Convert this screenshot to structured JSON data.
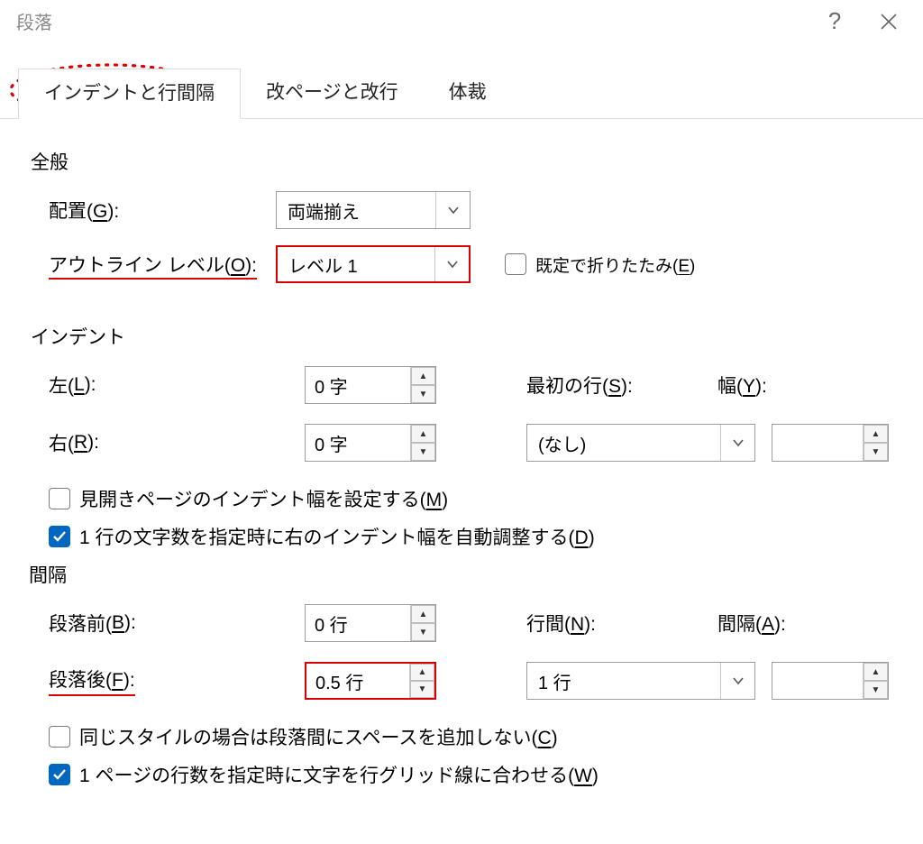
{
  "window": {
    "title": "段落",
    "help": "?",
    "close": "✕"
  },
  "tabs": {
    "t1": "インデントと行間隔",
    "t2": "改ページと改行",
    "t3": "体裁"
  },
  "general": {
    "section": "全般",
    "alignment_label_pre": "配置(",
    "alignment_key": "G",
    "alignment_label_post": "):",
    "alignment_value": "両端揃え",
    "outline_label_pre": "アウトライン レベル(",
    "outline_key": "O",
    "outline_label_post": "):",
    "outline_value": "レベル 1",
    "collapse_cb_pre": "既定で折りたたみ(",
    "collapse_key": "E",
    "collapse_cb_post": ")"
  },
  "indent": {
    "section": "インデント",
    "left_pre": "左(",
    "left_key": "L",
    "left_post": "):",
    "left_value": "0 字",
    "right_pre": "右(",
    "right_key": "R",
    "right_post": "):",
    "right_value": "0 字",
    "first_pre": "最初の行(",
    "first_key": "S",
    "first_post": "):",
    "first_value": "(なし)",
    "width_pre": "幅(",
    "width_key": "Y",
    "width_post": "):",
    "width_value": "",
    "mirror_cb_pre": "見開きページのインデント幅を設定する(",
    "mirror_key": "M",
    "mirror_cb_post": ")",
    "auto_cb_pre": "1 行の文字数を指定時に右のインデント幅を自動調整する(",
    "auto_key": "D",
    "auto_cb_post": ")"
  },
  "spacing": {
    "section": "間隔",
    "before_pre": "段落前(",
    "before_key": "B",
    "before_post": "):",
    "before_value": "0 行",
    "after_pre": "段落後(",
    "after_key": "F",
    "after_post": "):",
    "after_value": "0.5 行",
    "line_pre": "行間(",
    "line_key": "N",
    "line_post": "):",
    "line_value": "1 行",
    "at_pre": "間隔(",
    "at_key": "A",
    "at_post": "):",
    "at_value": "",
    "same_cb_pre": "同じスタイルの場合は段落間にスペースを追加しない(",
    "same_key": "C",
    "same_cb_post": ")",
    "grid_cb_pre": "1 ページの行数を指定時に文字を行グリッド線に合わせる(",
    "grid_key": "W",
    "grid_cb_post": ")"
  }
}
